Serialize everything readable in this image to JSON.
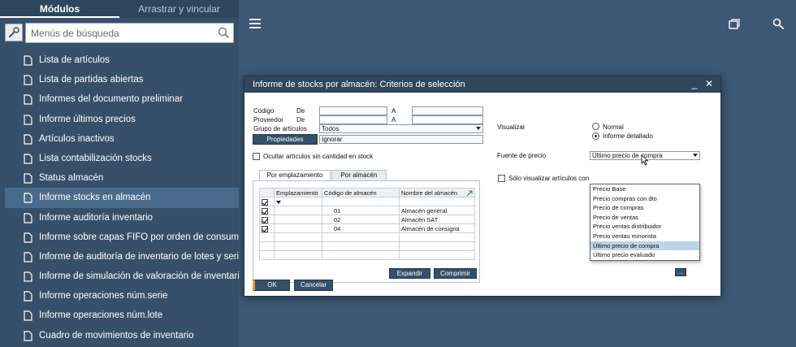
{
  "sidebar": {
    "tabs": [
      {
        "label": "Módulos"
      },
      {
        "label": "Arrastrar y vincular"
      }
    ],
    "search": {
      "placeholder": "Menús de búsqueda"
    },
    "items": [
      {
        "label": "Lista de artículos"
      },
      {
        "label": "Lista de partidas abiertas"
      },
      {
        "label": "Informes del documento preliminar"
      },
      {
        "label": "Informe últimos precios"
      },
      {
        "label": "Artículos inactivos"
      },
      {
        "label": "Lista contabilización stocks"
      },
      {
        "label": "Status almacén"
      },
      {
        "label": "Informe stocks en almacén"
      },
      {
        "label": "Informe auditoría inventario"
      },
      {
        "label": "Informe sobre capas FIFO por orden de consumo"
      },
      {
        "label": "Informe de auditoría de inventario de lotes y series"
      },
      {
        "label": "Informe de simulación de valoración de inventario"
      },
      {
        "label": "Informe operaciones núm.serie"
      },
      {
        "label": "Informe operaciones núm.lote"
      },
      {
        "label": "Cuadro de movimientos de inventario"
      }
    ],
    "selected_index": 7
  },
  "dialog": {
    "title": "Informe de stocks por almacén: Criterios de selección",
    "min_glyph": "_",
    "close_glyph": "✕",
    "fields": {
      "codigo_label": "Código",
      "proveedor_label": "Proveedor",
      "grupo_label": "Grupo de artículos",
      "de_label": "De",
      "a_label": "A",
      "grupo_value": "Todos",
      "propiedades_button": "Propiedades",
      "ignorar_value": "Ignorar"
    },
    "ocultar_label": "Ocultar artículos sin cantidad en stock",
    "tabs": [
      {
        "label": "Por emplazamiento"
      },
      {
        "label": "Por almacén"
      }
    ],
    "grid": {
      "columns": [
        "",
        "Emplazamiento",
        "Código de almacén",
        "Nombre del almacén"
      ],
      "rows": [
        {
          "code": "01",
          "name": "Almacén general"
        },
        {
          "code": "02",
          "name": "Almacén SAT"
        },
        {
          "code": "04",
          "name": "Almacén de consigna"
        }
      ]
    },
    "expand_button": "Expandir",
    "compress_button": "Comprimir",
    "ok_button": "OK",
    "cancel_button": "Cancelar",
    "visualizar_label": "Visualizar",
    "radio_normal": "Normal",
    "radio_detallado": "Informe detallado",
    "fuente_label": "Fuente de precio",
    "fuente_value": "Último precio de compra",
    "solo_label": "Sólo visualizar artículos con",
    "ellipsis_button": "...",
    "price_options": [
      {
        "label": "Precio Base"
      },
      {
        "label": "Precio compras con dto"
      },
      {
        "label": "Precio de compras"
      },
      {
        "label": "Precio de ventas"
      },
      {
        "label": "Precio ventas distribuidor"
      },
      {
        "label": "Precio ventas minorista"
      },
      {
        "label": "Último precio de compra"
      },
      {
        "label": "Último precio evaluado"
      }
    ]
  },
  "colors": {
    "background": "#3c5874",
    "sidebar": "#37506a",
    "dialog_title": "#2f465d",
    "highlight": "#bfd2ea"
  }
}
